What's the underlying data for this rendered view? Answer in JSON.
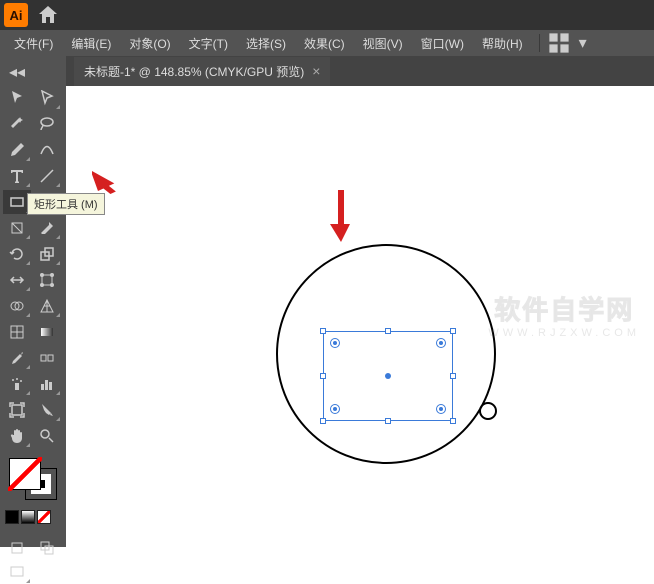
{
  "app": {
    "logo": "Ai"
  },
  "menu": {
    "file": "文件(F)",
    "edit": "编辑(E)",
    "object": "对象(O)",
    "type": "文字(T)",
    "select": "选择(S)",
    "effect": "效果(C)",
    "view": "视图(V)",
    "window": "窗口(W)",
    "help": "帮助(H)"
  },
  "tab": {
    "title": "未标题-1* @ 148.85% (CMYK/GPU 预览)",
    "close": "×"
  },
  "tooltip": {
    "rectangle": "矩形工具 (M)"
  },
  "watermark": {
    "main": "软件自学网",
    "sub": "WWW.RJZXW.COM"
  }
}
